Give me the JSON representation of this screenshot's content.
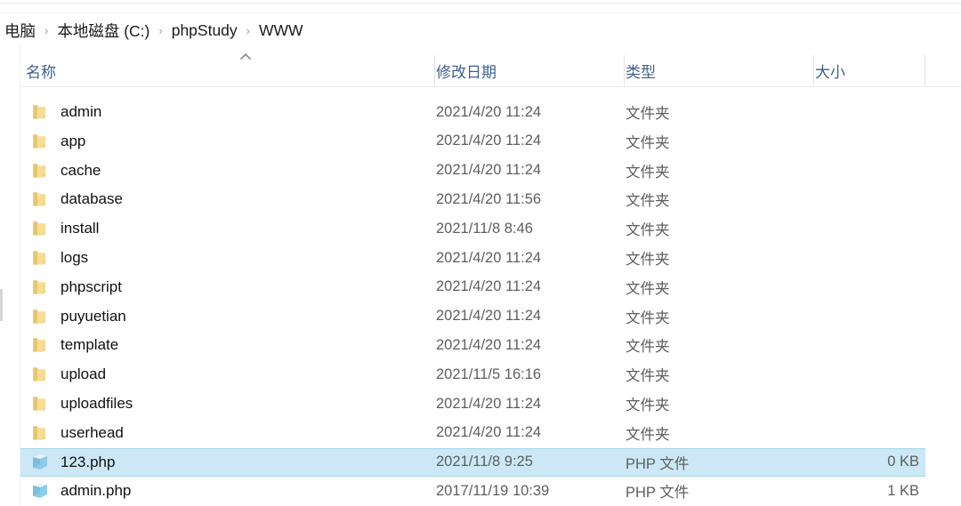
{
  "window": {
    "app": "file-explorer",
    "accent_selection_bg": "#cce8f6",
    "accent_selection_border": "#a7d4ea",
    "header_text_color": "#41618f",
    "folder_icon_color": "#f5d98a",
    "php_icon_color": "#7fc4e8"
  },
  "breadcrumb": {
    "separator": "›",
    "items": [
      {
        "label": "电脑"
      },
      {
        "label": "本地磁盘 (C:)"
      },
      {
        "label": "phpStudy"
      },
      {
        "label": "WWW"
      }
    ]
  },
  "columns": {
    "name": "名称",
    "date_modified": "修改日期",
    "type": "类型",
    "size": "大小",
    "sort_column": "名称",
    "sort_direction": "ascending",
    "sort_caret_icon": "chevron-up-icon"
  },
  "files": [
    {
      "name": "admin",
      "date": "2021/4/20 11:24",
      "type": "文件夹",
      "size": "",
      "icon": "folder-icon",
      "selected": false
    },
    {
      "name": "app",
      "date": "2021/4/20 11:24",
      "type": "文件夹",
      "size": "",
      "icon": "folder-icon",
      "selected": false
    },
    {
      "name": "cache",
      "date": "2021/4/20 11:24",
      "type": "文件夹",
      "size": "",
      "icon": "folder-icon",
      "selected": false
    },
    {
      "name": "database",
      "date": "2021/4/20 11:56",
      "type": "文件夹",
      "size": "",
      "icon": "folder-icon",
      "selected": false
    },
    {
      "name": "install",
      "date": "2021/11/8 8:46",
      "type": "文件夹",
      "size": "",
      "icon": "folder-icon",
      "selected": false
    },
    {
      "name": "logs",
      "date": "2021/4/20 11:24",
      "type": "文件夹",
      "size": "",
      "icon": "folder-icon",
      "selected": false
    },
    {
      "name": "phpscript",
      "date": "2021/4/20 11:24",
      "type": "文件夹",
      "size": "",
      "icon": "folder-icon",
      "selected": false
    },
    {
      "name": "puyuetian",
      "date": "2021/4/20 11:24",
      "type": "文件夹",
      "size": "",
      "icon": "folder-icon",
      "selected": false
    },
    {
      "name": "template",
      "date": "2021/4/20 11:24",
      "type": "文件夹",
      "size": "",
      "icon": "folder-icon",
      "selected": false
    },
    {
      "name": "upload",
      "date": "2021/11/5 16:16",
      "type": "文件夹",
      "size": "",
      "icon": "folder-icon",
      "selected": false
    },
    {
      "name": "uploadfiles",
      "date": "2021/4/20 11:24",
      "type": "文件夹",
      "size": "",
      "icon": "folder-icon",
      "selected": false
    },
    {
      "name": "userhead",
      "date": "2021/4/20 11:24",
      "type": "文件夹",
      "size": "",
      "icon": "folder-icon",
      "selected": false
    },
    {
      "name": "123.php",
      "date": "2021/11/8 9:25",
      "type": "PHP 文件",
      "size": "0 KB",
      "icon": "php-file-icon",
      "selected": true
    },
    {
      "name": "admin.php",
      "date": "2017/11/19 10:39",
      "type": "PHP 文件",
      "size": "1 KB",
      "icon": "php-file-icon",
      "selected": false
    }
  ]
}
